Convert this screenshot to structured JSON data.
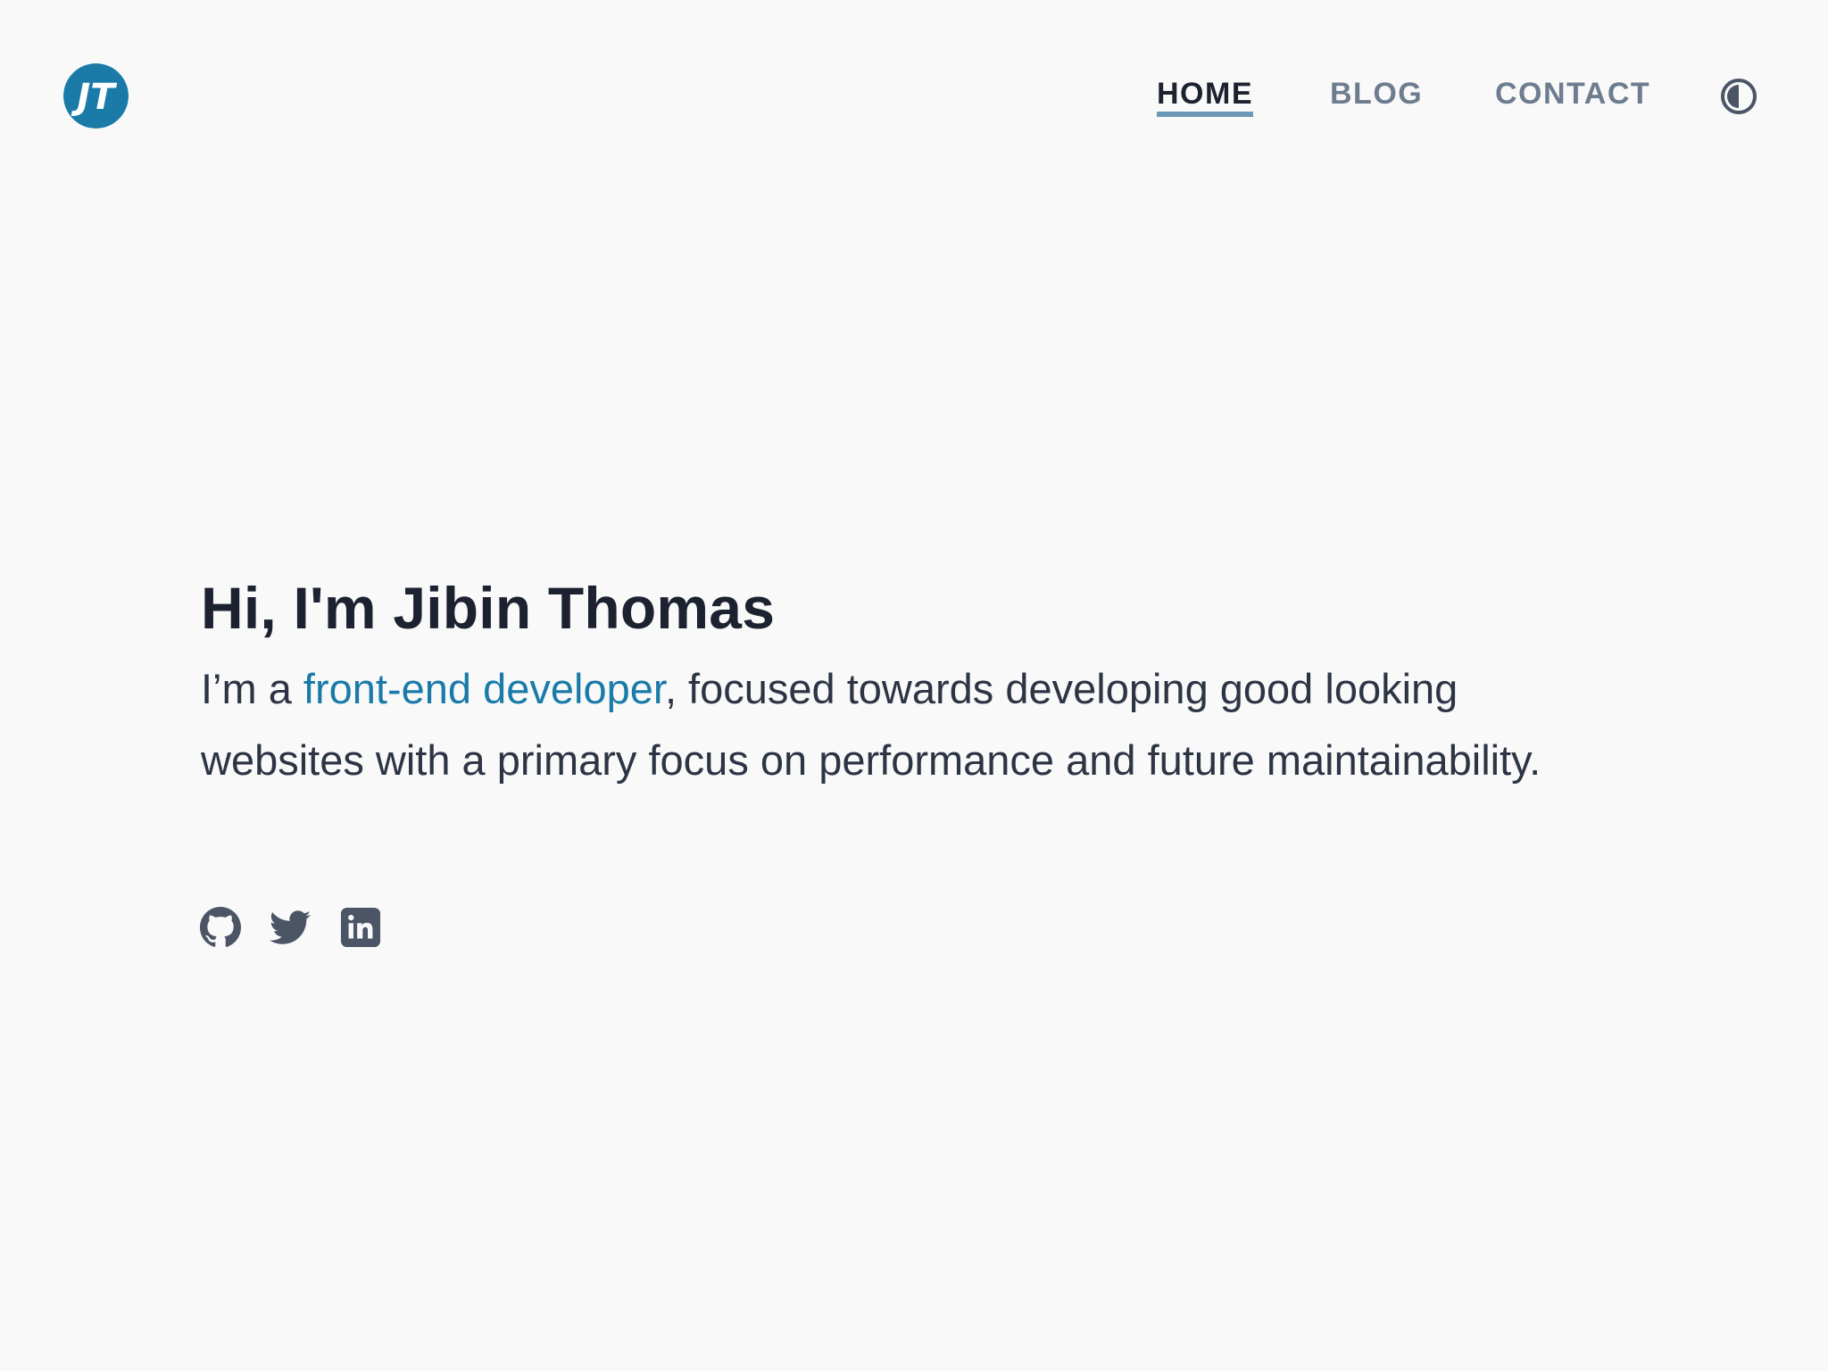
{
  "header": {
    "logo": {
      "icon": "jt-logo-icon",
      "text": "JT",
      "color": "#1a7aa8"
    },
    "nav": {
      "home_label": "HOME",
      "blog_label": "BLOG",
      "contact_label": "CONTACT",
      "active": "HOME",
      "active_color": "#1c2230",
      "inactive_color": "#6e7c8f",
      "underline_color": "#6b98b6"
    },
    "theme_toggle": {
      "icon": "contrast-icon"
    }
  },
  "hero": {
    "title": "Hi, I'm Jibin Thomas",
    "intro_prefix": "I’m a ",
    "intro_link": "front-end developer",
    "intro_suffix": ", focused towards developing good looking websites with a primary focus on performance and future maintainability.",
    "link_color": "#1a7aa8"
  },
  "socials": [
    {
      "icon": "github-icon"
    },
    {
      "icon": "twitter-icon"
    },
    {
      "icon": "linkedin-icon"
    }
  ],
  "colors": {
    "background": "#f9f9f9",
    "text_dark": "#1c2230",
    "text_body": "#2d3545",
    "icon": "#4b5566"
  }
}
